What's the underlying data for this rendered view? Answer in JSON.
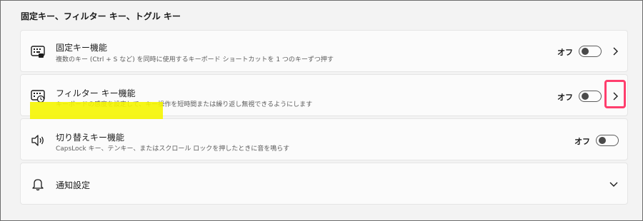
{
  "section": {
    "title": "固定キー、フィルター キー、トグル キー"
  },
  "items": [
    {
      "title": "固定キー機能",
      "desc": "複数のキー (Ctrl + S など) を同時に使用するキーボード ショートカットを 1 つのキーずつ押す",
      "state": "オフ",
      "icon": "sticky-keys-icon"
    },
    {
      "title": "フィルター キー機能",
      "desc": "キーボードの感度を設定して、キー操作を短時間または繰り返し無視できるようにします",
      "state": "オフ",
      "icon": "filter-keys-icon"
    },
    {
      "title": "切り替えキー機能",
      "desc": "CapsLock キー、テンキー、またはスクロール ロックを押したときに音を鳴らす",
      "state": "オフ",
      "icon": "speaker-icon"
    },
    {
      "title": "通知設定",
      "icon": "bell-icon"
    }
  ],
  "colors": {
    "highlight": "#f5f500",
    "annotation_box": "#ff3e6d"
  }
}
